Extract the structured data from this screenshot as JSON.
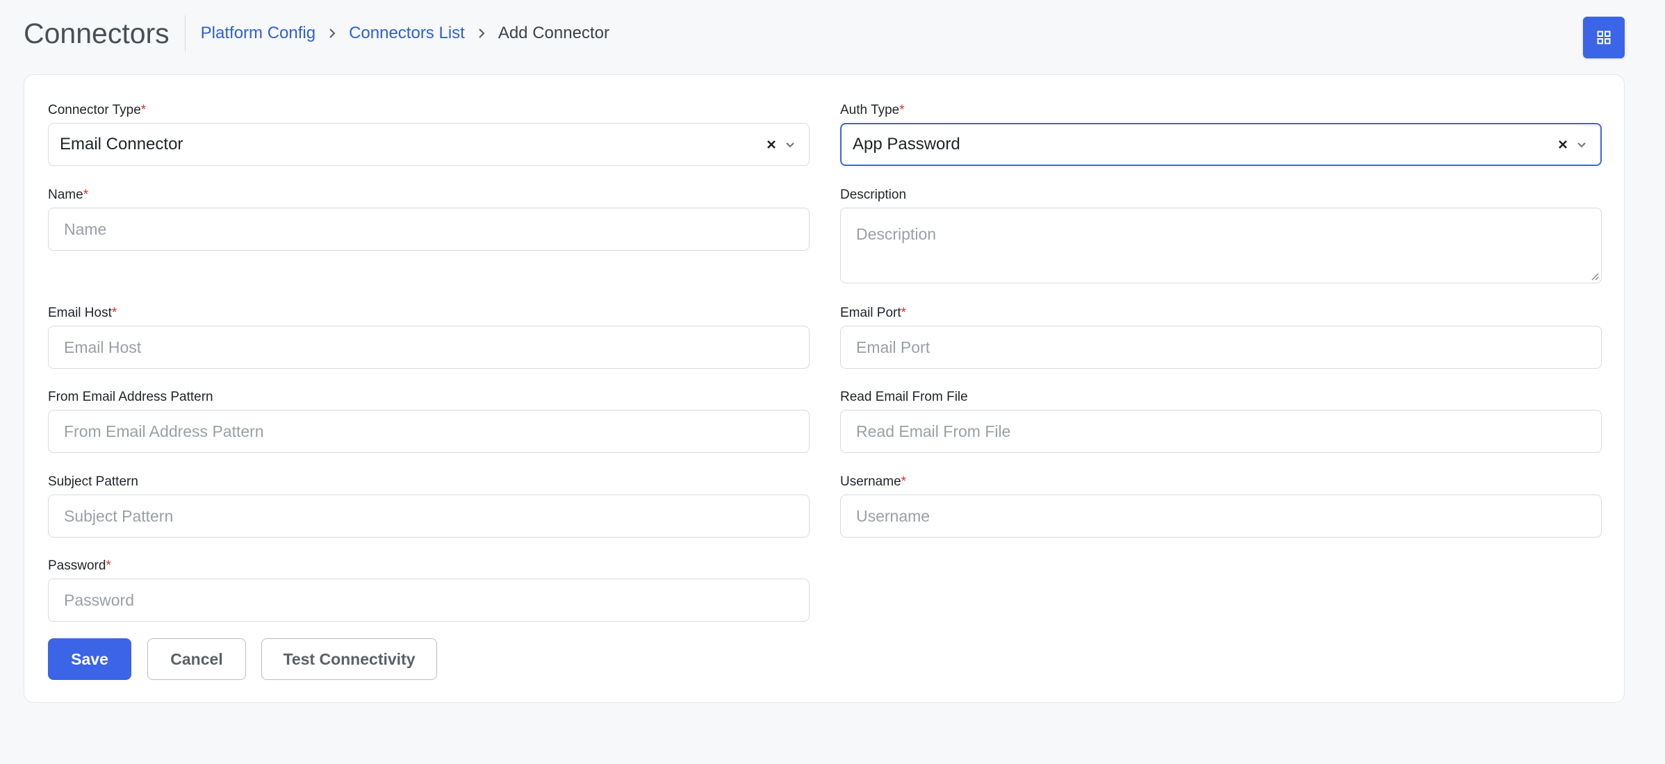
{
  "header": {
    "title": "Connectors",
    "breadcrumb": [
      "Platform Config",
      "Connectors List",
      "Add Connector"
    ]
  },
  "form": {
    "connector_type": {
      "label": "Connector Type",
      "required": "*",
      "value": "Email Connector"
    },
    "auth_type": {
      "label": "Auth Type",
      "required": "*",
      "value": "App Password"
    },
    "name": {
      "label": "Name",
      "required": "*",
      "placeholder": "Name"
    },
    "description": {
      "label": "Description",
      "placeholder": "Description"
    },
    "email_host": {
      "label": "Email Host",
      "required": "*",
      "placeholder": "Email Host"
    },
    "email_port": {
      "label": "Email Port",
      "required": "*",
      "placeholder": "Email Port"
    },
    "from_pattern": {
      "label": "From Email Address Pattern",
      "placeholder": "From Email Address Pattern"
    },
    "read_from_file": {
      "label": "Read Email From File",
      "placeholder": "Read Email From File"
    },
    "subject_pattern": {
      "label": "Subject Pattern",
      "placeholder": "Subject Pattern"
    },
    "username": {
      "label": "Username",
      "required": "*",
      "placeholder": "Username"
    },
    "password": {
      "label": "Password",
      "required": "*",
      "placeholder": "Password"
    }
  },
  "actions": {
    "save": "Save",
    "cancel": "Cancel",
    "test": "Test Connectivity"
  },
  "colors": {
    "accent": "#3b64e6",
    "link": "#2f5fd3",
    "required": "#d93025"
  },
  "icons": {
    "apps": "grid-icon",
    "clear": "close-icon",
    "dropdown": "chevron-down-icon",
    "separator": "chevron-right-icon"
  }
}
